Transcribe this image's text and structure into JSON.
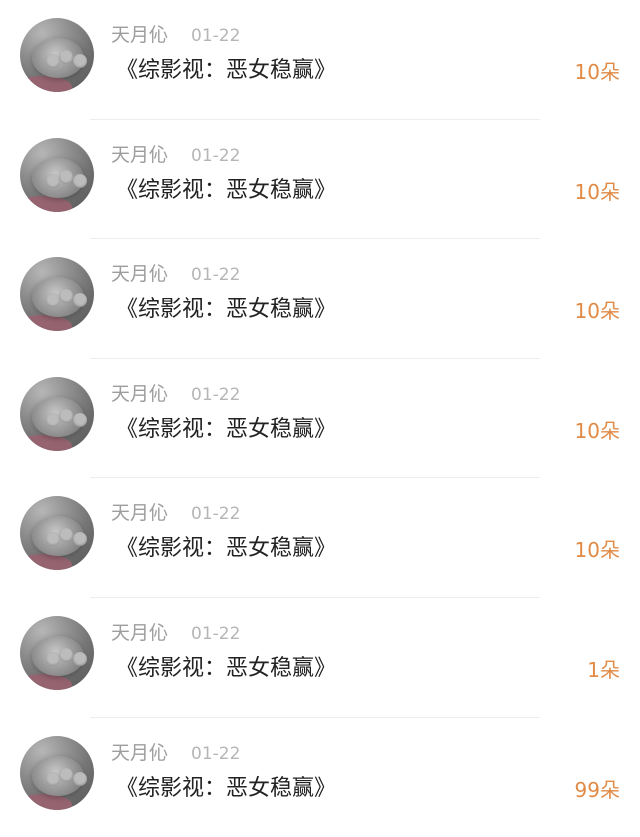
{
  "gift_list": {
    "items": [
      {
        "user": "天月伈",
        "date": "01-22",
        "book_title": "《综影视：恶女稳赢》",
        "amount": "10朵"
      },
      {
        "user": "天月伈",
        "date": "01-22",
        "book_title": "《综影视：恶女稳赢》",
        "amount": "10朵"
      },
      {
        "user": "天月伈",
        "date": "01-22",
        "book_title": "《综影视：恶女稳赢》",
        "amount": "10朵"
      },
      {
        "user": "天月伈",
        "date": "01-22",
        "book_title": "《综影视：恶女稳赢》",
        "amount": "10朵"
      },
      {
        "user": "天月伈",
        "date": "01-22",
        "book_title": "《综影视：恶女稳赢》",
        "amount": "10朵"
      },
      {
        "user": "天月伈",
        "date": "01-22",
        "book_title": "《综影视：恶女稳赢》",
        "amount": "1朵"
      },
      {
        "user": "天月伈",
        "date": "01-22",
        "book_title": "《综影视：恶女稳赢》",
        "amount": "99朵"
      }
    ]
  },
  "avatar_icon": "cat-paw-avatar",
  "colors": {
    "accent": "#e18a45",
    "username": "#9d9d9d",
    "date": "#b6b6b6",
    "title": "#222222",
    "divider": "#eeeeee"
  }
}
